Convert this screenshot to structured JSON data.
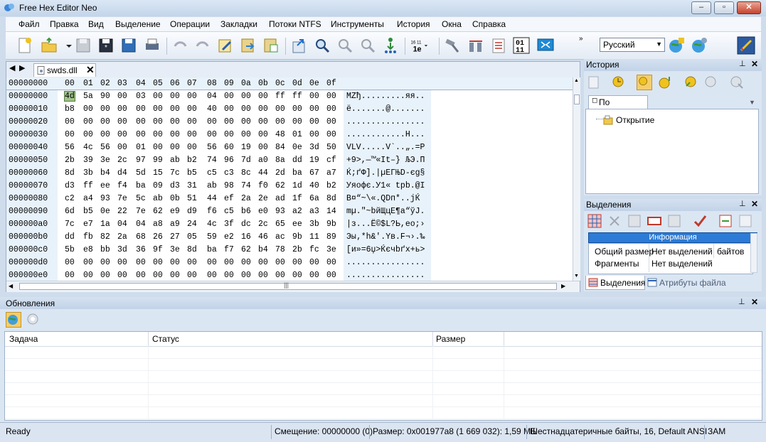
{
  "window": {
    "title": "Free Hex Editor Neo"
  },
  "menu": [
    "Файл",
    "Правка",
    "Вид",
    "Выделение",
    "Операции",
    "Закладки",
    "Потоки NTFS",
    "Инструменты",
    "История",
    "Окна",
    "Справка"
  ],
  "toolbar": {
    "language": "Русский"
  },
  "editor": {
    "tab_label": "swds.dll",
    "header_offset": "00000000",
    "header_cols": [
      "00",
      "01",
      "02",
      "03",
      "04",
      "05",
      "06",
      "07",
      "08",
      "09",
      "0a",
      "0b",
      "0c",
      "0d",
      "0e",
      "0f"
    ],
    "rows": [
      {
        "off": "00000000",
        "hex": [
          "4d",
          "5a",
          "90",
          "00",
          "03",
          "00",
          "00",
          "00",
          "04",
          "00",
          "00",
          "00",
          "ff",
          "ff",
          "00",
          "00"
        ],
        "ascii": "MZђ.........яя.."
      },
      {
        "off": "00000010",
        "hex": [
          "b8",
          "00",
          "00",
          "00",
          "00",
          "00",
          "00",
          "00",
          "40",
          "00",
          "00",
          "00",
          "00",
          "00",
          "00",
          "00"
        ],
        "ascii": "ё.......@......."
      },
      {
        "off": "00000020",
        "hex": [
          "00",
          "00",
          "00",
          "00",
          "00",
          "00",
          "00",
          "00",
          "00",
          "00",
          "00",
          "00",
          "00",
          "00",
          "00",
          "00"
        ],
        "ascii": "................"
      },
      {
        "off": "00000030",
        "hex": [
          "00",
          "00",
          "00",
          "00",
          "00",
          "00",
          "00",
          "00",
          "00",
          "00",
          "00",
          "00",
          "48",
          "01",
          "00",
          "00"
        ],
        "ascii": "............H..."
      },
      {
        "off": "00000040",
        "hex": [
          "56",
          "4c",
          "56",
          "00",
          "01",
          "00",
          "00",
          "00",
          "56",
          "60",
          "19",
          "00",
          "84",
          "0e",
          "3d",
          "50"
        ],
        "ascii": "VLV.....V`..„.=P"
      },
      {
        "off": "00000050",
        "hex": [
          "2b",
          "39",
          "3e",
          "2c",
          "97",
          "99",
          "ab",
          "b2",
          "74",
          "96",
          "7d",
          "a0",
          "8a",
          "dd",
          "19",
          "cf"
        ],
        "ascii": "+9>,—™«Іt–} ЉЭ.П"
      },
      {
        "off": "00000060",
        "hex": [
          "8d",
          "3b",
          "b4",
          "d4",
          "5d",
          "15",
          "7c",
          "b5",
          "c5",
          "c3",
          "8c",
          "44",
          "2d",
          "ba",
          "67",
          "a7"
        ],
        "ascii": "Ќ;ґФ].|µЕГЊD-єg§"
      },
      {
        "off": "00000070",
        "hex": [
          "d3",
          "ff",
          "ee",
          "f4",
          "ba",
          "09",
          "d3",
          "31",
          "ab",
          "98",
          "74",
          "f0",
          "62",
          "1d",
          "40",
          "b2"
        ],
        "ascii": "Уяофє.У1« tрb.@І"
      },
      {
        "off": "00000080",
        "hex": [
          "c2",
          "a4",
          "93",
          "7e",
          "5c",
          "ab",
          "0b",
          "51",
          "44",
          "ef",
          "2a",
          "2e",
          "ad",
          "1f",
          "6a",
          "8d"
        ],
        "ascii": "В¤“~\\«.QDп*.­.jЌ"
      },
      {
        "off": "00000090",
        "hex": [
          "6d",
          "b5",
          "0e",
          "22",
          "7e",
          "62",
          "e9",
          "d9",
          "f6",
          "c5",
          "b6",
          "e0",
          "93",
          "a2",
          "a3",
          "14"
        ],
        "ascii": "mµ.\"~bйЩцЕ¶а“ўЈ."
      },
      {
        "off": "000000a0",
        "hex": [
          "7c",
          "e7",
          "1a",
          "04",
          "04",
          "a8",
          "a9",
          "24",
          "4c",
          "3f",
          "dc",
          "2c",
          "65",
          "ee",
          "3b",
          "9b"
        ],
        "ascii": "|з...Ё©$L?Ь,eо;›"
      },
      {
        "off": "000000b0",
        "hex": [
          "dd",
          "fb",
          "82",
          "2a",
          "68",
          "26",
          "27",
          "05",
          "59",
          "e2",
          "16",
          "46",
          "ac",
          "9b",
          "11",
          "89"
        ],
        "ascii": "Эы‚*h&'.Yв.F¬›.‰"
      },
      {
        "off": "000000c0",
        "hex": [
          "5b",
          "e8",
          "bb",
          "3d",
          "36",
          "9f",
          "3e",
          "8d",
          "ba",
          "f7",
          "62",
          "b4",
          "78",
          "2b",
          "fc",
          "3e"
        ],
        "ascii": "[и»=6џ>Ќєчbґx+ь>"
      },
      {
        "off": "000000d0",
        "hex": [
          "00",
          "00",
          "00",
          "00",
          "00",
          "00",
          "00",
          "00",
          "00",
          "00",
          "00",
          "00",
          "00",
          "00",
          "00",
          "00"
        ],
        "ascii": "................"
      },
      {
        "off": "000000e0",
        "hex": [
          "00",
          "00",
          "00",
          "00",
          "00",
          "00",
          "00",
          "00",
          "00",
          "00",
          "00",
          "00",
          "00",
          "00",
          "00",
          "00"
        ],
        "ascii": "................"
      }
    ]
  },
  "history": {
    "title": "История",
    "tab": "По умолча...",
    "item": "Открытие"
  },
  "selection": {
    "title": "Выделения",
    "info_header": "Информация",
    "rows": [
      {
        "label": "Общий размер",
        "value": "Нет выделений",
        "unit": "байтов"
      },
      {
        "label": "Фрагменты",
        "value": "Нет выделений",
        "unit": ""
      }
    ],
    "tab_selections": "Выделения",
    "tab_attributes": "Атрибуты файла"
  },
  "updates": {
    "title": "Обновления",
    "columns": [
      "Задача",
      "Статус",
      "Размер"
    ]
  },
  "status": {
    "ready": "Ready",
    "offset": "Смещение: 00000000 (0)",
    "size": "Размер: 0x001977a8 (1 669 032): 1,59 МБ",
    "mode": "Шестнадцатеричные байты, 16, Default ANSI",
    "insert": "ЗАМ"
  }
}
